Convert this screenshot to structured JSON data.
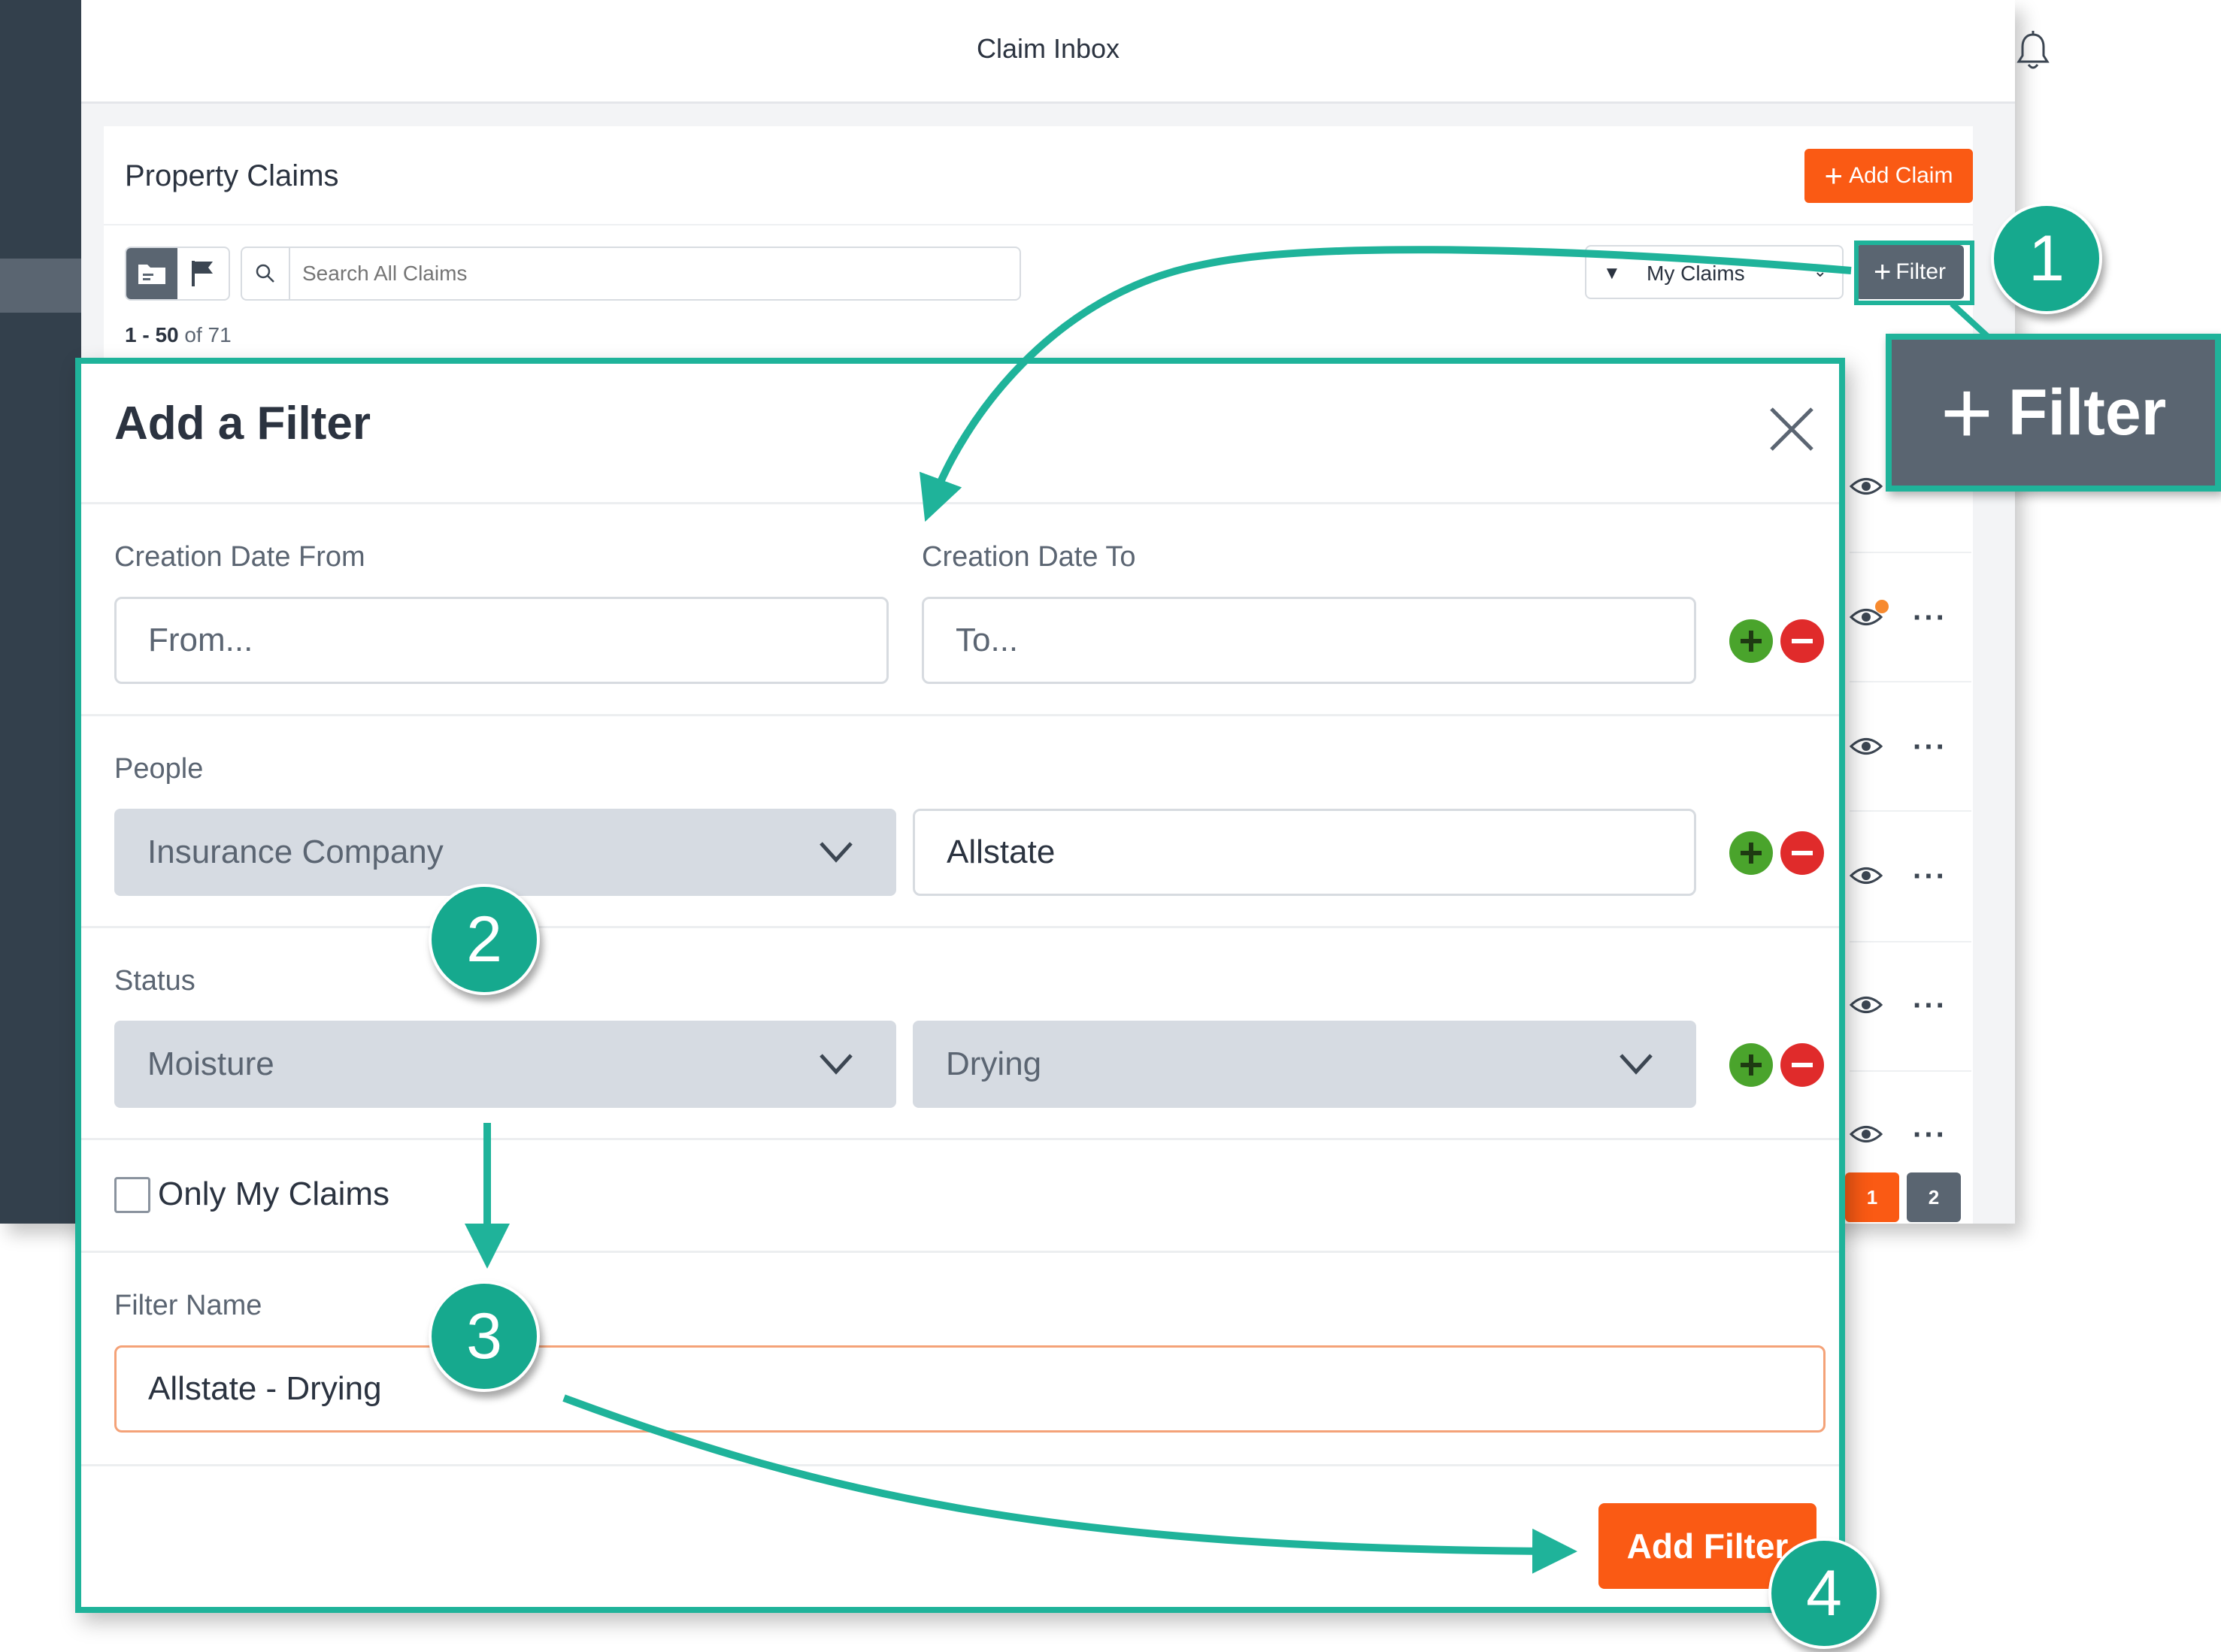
{
  "app": {
    "title": "Claim Inbox",
    "card_title": "Property Claims",
    "add_claim_label": "Add Claim",
    "search_placeholder": "Search All Claims",
    "my_claims_value": "My Claims",
    "filter_label": "Filter",
    "range": {
      "start_end": "1 - 50",
      "of_total": "of 71"
    },
    "pages": [
      "1",
      "2"
    ],
    "current_page": "1"
  },
  "modal": {
    "title": "Add a Filter",
    "creation_date_from_label": "Creation Date From",
    "creation_date_to_label": "Creation Date To",
    "from_placeholder": "From...",
    "to_placeholder": "To...",
    "people_label": "People",
    "people_type": "Insurance Company",
    "people_value": "Allstate",
    "status_label": "Status",
    "status_type": "Moisture",
    "status_value": "Drying",
    "only_my_claims_label": "Only My Claims",
    "only_my_claims_checked": false,
    "filter_name_label": "Filter Name",
    "filter_name_value": "Allstate - Drying",
    "add_filter_label": "Add Filter"
  },
  "callouts": {
    "zoom_filter_label": "Filter",
    "steps": [
      "1",
      "2",
      "3",
      "4"
    ]
  },
  "colors": {
    "accent_orange": "#fa5a14",
    "callout_teal": "#16a98e",
    "highlight_teal": "#1fb39a",
    "nav_dark": "#33404c",
    "slate_button": "#5a6571",
    "add_green": "#4aa42c",
    "remove_red": "#e02b2b"
  }
}
